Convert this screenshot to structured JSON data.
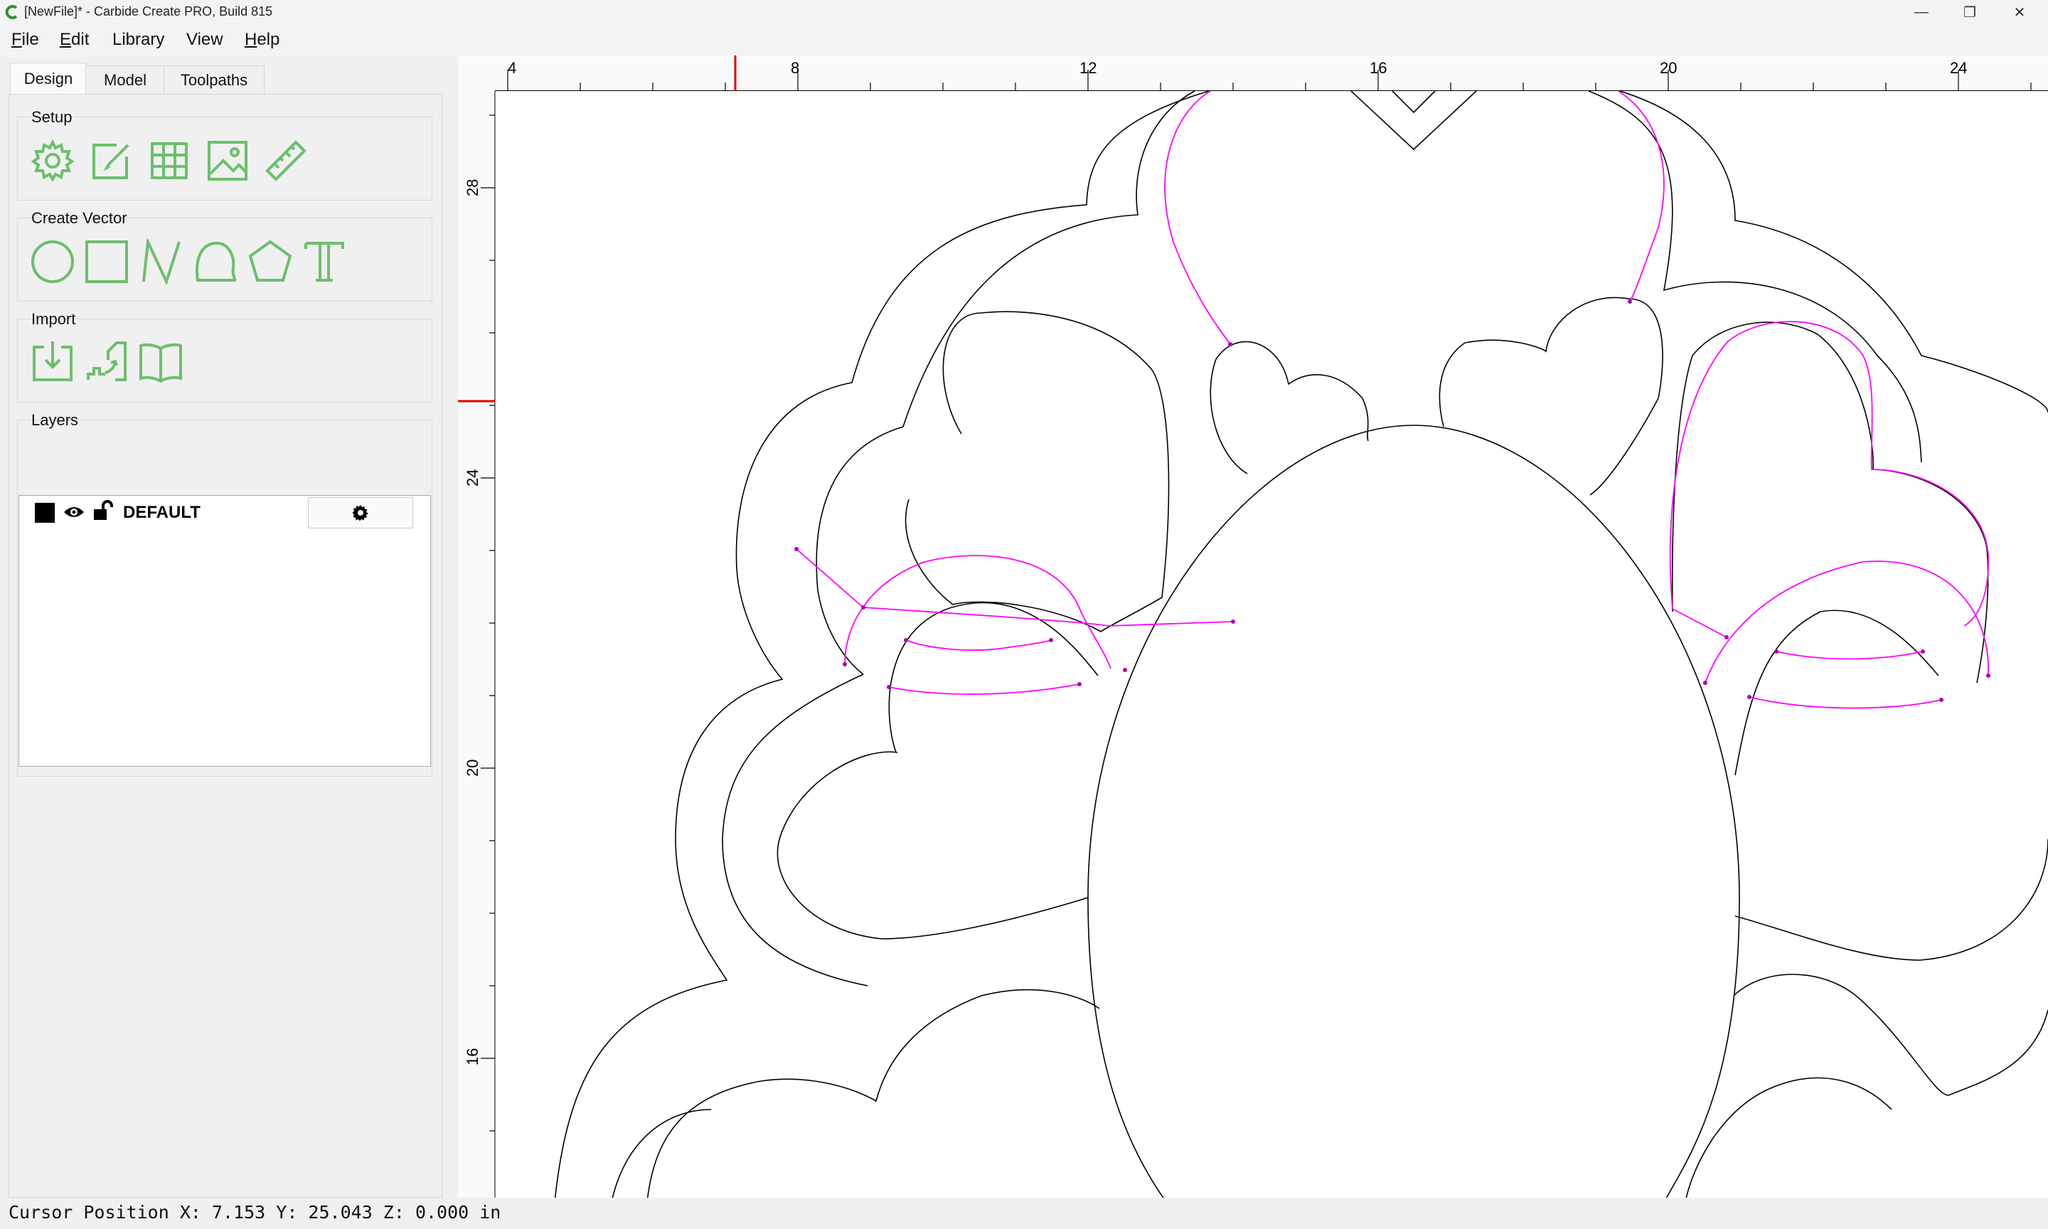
{
  "window": {
    "title": "[NewFile]* - Carbide Create PRO, Build 815",
    "app_icon": "carbide-create-icon",
    "minimize_glyph": "—",
    "maximize_glyph": "❐",
    "close_glyph": "✕"
  },
  "menu": {
    "file": {
      "u": "F",
      "rest": "ile"
    },
    "edit": {
      "u": "E",
      "rest": "dit"
    },
    "library": {
      "label": "Library"
    },
    "view": {
      "label": "View"
    },
    "help": {
      "u": "H",
      "rest": "elp"
    }
  },
  "tabs": [
    {
      "label": "Design",
      "active": true
    },
    {
      "label": "Model",
      "active": false
    },
    {
      "label": "Toolpaths",
      "active": false
    }
  ],
  "groups": {
    "setup": {
      "title": "Setup",
      "icons": [
        "gear-icon",
        "edit-icon",
        "grid-icon",
        "image-icon",
        "ruler-icon"
      ]
    },
    "create_vector": {
      "title": "Create Vector",
      "icons": [
        "circle-icon",
        "rectangle-icon",
        "polyline-icon",
        "curve-icon",
        "polygon-icon",
        "text-icon"
      ]
    },
    "import": {
      "title": "Import",
      "icons": [
        "import-icon",
        "stair-icon",
        "book-icon"
      ]
    },
    "layers": {
      "title": "Layers"
    }
  },
  "layers": [
    {
      "name": "DEFAULT",
      "color": "#000000",
      "visible": true,
      "locked": false
    }
  ],
  "colors": {
    "accent_green": "#6cbf6c",
    "selection_magenta": "#ff00ff",
    "ruler_marker": "#e00000"
  },
  "rulers": {
    "top_labels": [
      "4",
      "8",
      "12",
      "16",
      "20",
      "24"
    ],
    "left_labels": [
      "28",
      "24",
      "20",
      "16"
    ]
  },
  "status": {
    "text": "Cursor Position X: 7.153 Y: 25.043 Z: 0.000 in"
  }
}
